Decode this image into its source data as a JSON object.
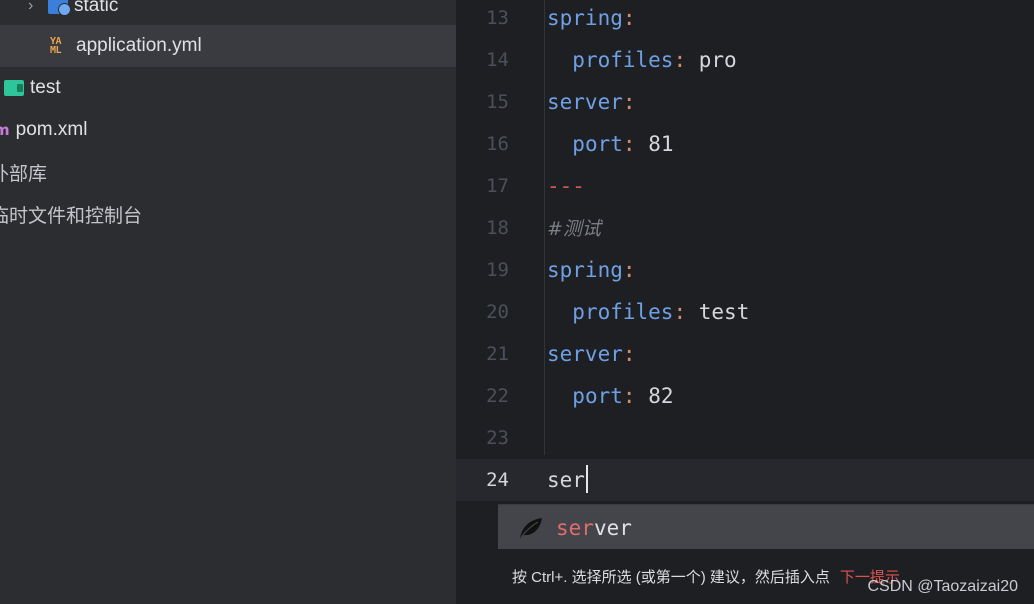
{
  "tree": {
    "items": [
      {
        "label": "static",
        "icon": "folder-resources-icon"
      },
      {
        "label": "application.yml",
        "icon": "yaml-file-icon"
      },
      {
        "label": "test",
        "icon": "folder-test-icon"
      },
      {
        "label": "pom.xml",
        "icon": "maven-icon"
      },
      {
        "label": "外部库"
      },
      {
        "label": "临时文件和控制台"
      }
    ]
  },
  "editor": {
    "lines": [
      {
        "n": "13"
      },
      {
        "n": "14"
      },
      {
        "n": "15"
      },
      {
        "n": "16"
      },
      {
        "n": "17"
      },
      {
        "n": "18"
      },
      {
        "n": "19"
      },
      {
        "n": "20"
      },
      {
        "n": "21"
      },
      {
        "n": "22"
      },
      {
        "n": "23"
      },
      {
        "n": "24"
      }
    ],
    "tokens": {
      "spring": "spring",
      "profiles": "profiles",
      "server": "server",
      "port": "port",
      "colon": ":",
      "pro": "pro",
      "test": "test",
      "p81": "81",
      "p82": "82",
      "separator": "---",
      "comment": "#测试",
      "typed": "ser"
    }
  },
  "completion": {
    "match": "ser",
    "rest": "ver",
    "icon": "spring-leaf-icon"
  },
  "hint": {
    "text": "按 Ctrl+. 选择所选 (或第一个) 建议，然后插入点",
    "link": "下一提示"
  },
  "watermark": "CSDN @Taozaizai20"
}
